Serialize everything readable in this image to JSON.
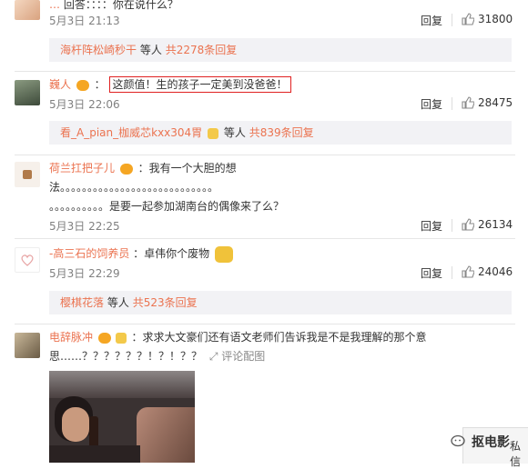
{
  "comments": [
    {
      "user": "…",
      "text": "回答：：：：你在说什么？",
      "time": "5月3日 21:13",
      "reply_label": "回复",
      "likes": "31800",
      "replies": {
        "users": "海杆阵松崎秒干",
        "suffix_others": "等人",
        "count": "共2278条回复"
      }
    },
    {
      "user": "巍人",
      "text": "这颜值！生的孩子一定美到没爸爸！",
      "time": "5月3日 22:06",
      "reply_label": "回复",
      "likes": "28475",
      "replies": {
        "users": "看_A_pian_枷威芯kxx304胃",
        "suffix_others": "等人",
        "count": "共839条回复"
      }
    },
    {
      "user": "荷兰扛把子儿",
      "text_line1": "：我有一个大胆的想",
      "text_line2": "法。。。。。。。。。。。。。。。。。。。。。。。。。。。。",
      "text_line3": "。。。。。。。。。。是要一起参加湖南台的偶像来了么？",
      "time": "5月3日 22:25",
      "reply_label": "回复",
      "likes": "26134"
    },
    {
      "user": "-高三石的饲养员",
      "text": "：卓伟你个废物",
      "time": "5月3日 22:29",
      "reply_label": "回复",
      "likes": "24046",
      "replies": {
        "users": "樱棋花落",
        "suffix_others": "等人",
        "count": "共523条回复"
      }
    },
    {
      "user": "电辞脉冲",
      "text_line1": "：求求大文豪们还有语文老师们告诉我是不是我理解的那个意",
      "text_line2": "思……？？？？？？！？！？？",
      "view_image": "评论配图"
    }
  ],
  "watermark": {
    "text": "抠电影",
    "extra": "私信"
  },
  "colors": {
    "accent": "#eb7350",
    "reply_bg": "#f2f2f5",
    "highlight_border": "#e02020"
  }
}
